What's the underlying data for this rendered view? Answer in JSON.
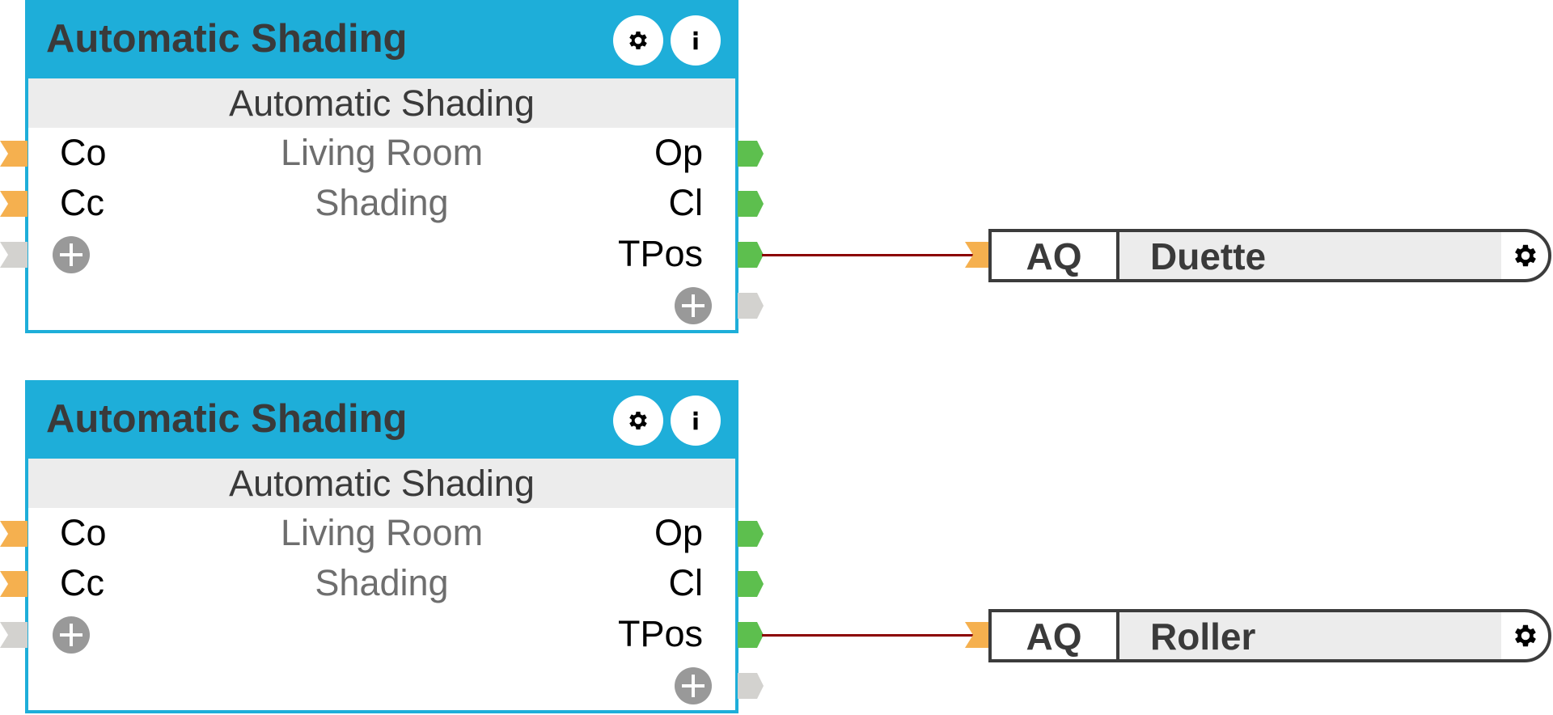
{
  "blocks": [
    {
      "title": "Automatic Shading",
      "subtitle": "Automatic Shading",
      "room": "Living Room",
      "category": "Shading",
      "inputs": [
        "Co",
        "Cc"
      ],
      "outputs": [
        "Op",
        "Cl",
        "TPos"
      ],
      "icons": {
        "settings": "gear-icon",
        "info": "info-icon",
        "add": "plus-icon"
      },
      "connection": {
        "from_output": "TPos",
        "to_block": "AQ Duette"
      }
    },
    {
      "title": "Automatic Shading",
      "subtitle": "Automatic Shading",
      "room": "Living Room",
      "category": "Shading",
      "inputs": [
        "Co",
        "Cc"
      ],
      "outputs": [
        "Op",
        "Cl",
        "TPos"
      ],
      "icons": {
        "settings": "gear-icon",
        "info": "info-icon",
        "add": "plus-icon"
      },
      "connection": {
        "from_output": "TPos",
        "to_block": "AQ Roller"
      }
    }
  ],
  "actuators": [
    {
      "type": "AQ",
      "name": "Duette"
    },
    {
      "type": "AQ",
      "name": "Roller"
    }
  ],
  "colors": {
    "block_header": "#1eaed9",
    "input_connector": "#f5b04f",
    "output_connector": "#5dbf4e",
    "unused_connector": "#d3d2cf",
    "wire": "#8b0000",
    "subtitle_band": "#ececec"
  }
}
